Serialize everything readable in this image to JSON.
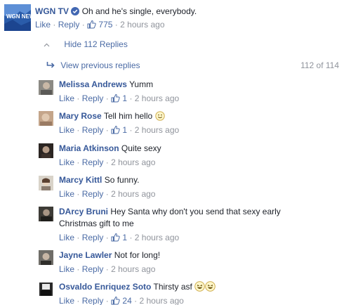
{
  "top_comment": {
    "author": "WGN TV",
    "text": "Oh and he's single, everybody.",
    "avatar_text": "WGN NEWS",
    "like_label": "Like",
    "reply_label": "Reply",
    "likes": "775",
    "time": "2 hours ago"
  },
  "hide_replies_label": "Hide 112 Replies",
  "view_previous_label": "View previous replies",
  "reply_counter": "112 of 114",
  "replies": [
    {
      "author": "Melissa Andrews",
      "text": "Yumm",
      "like_label": "Like",
      "reply_label": "Reply",
      "likes": "1",
      "time": "2 hours ago"
    },
    {
      "author": "Mary Rose",
      "text": "Tell him hello",
      "like_label": "Like",
      "reply_label": "Reply",
      "likes": "1",
      "time": "2 hours ago"
    },
    {
      "author": "Maria Atkinson",
      "text": "Quite sexy",
      "like_label": "Like",
      "reply_label": "Reply",
      "time": "2 hours ago"
    },
    {
      "author": "Marcy Kittl",
      "text": "So funny.",
      "like_label": "Like",
      "reply_label": "Reply",
      "time": "2 hours ago"
    },
    {
      "author": "DArcy Bruni",
      "text": "Hey Santa why don't you send that sexy early",
      "text_line2": "Christmas gift to me",
      "like_label": "Like",
      "reply_label": "Reply",
      "likes": "1",
      "time": "2 hours ago"
    },
    {
      "author": "Jayne Lawler",
      "text": "Not for long!",
      "like_label": "Like",
      "reply_label": "Reply",
      "time": "2 hours ago"
    },
    {
      "author": "Osvaldo Enriquez Soto",
      "text": "Thirsty asf",
      "like_label": "Like",
      "reply_label": "Reply",
      "likes": "24",
      "time": "2 hours ago"
    }
  ],
  "colors": {
    "name_blue": "#365899",
    "link_blue": "#4b6ba5",
    "meta_gray": "#90949c",
    "verified_blue": "#4267b2",
    "wgn_blue": "#2a5caa"
  }
}
